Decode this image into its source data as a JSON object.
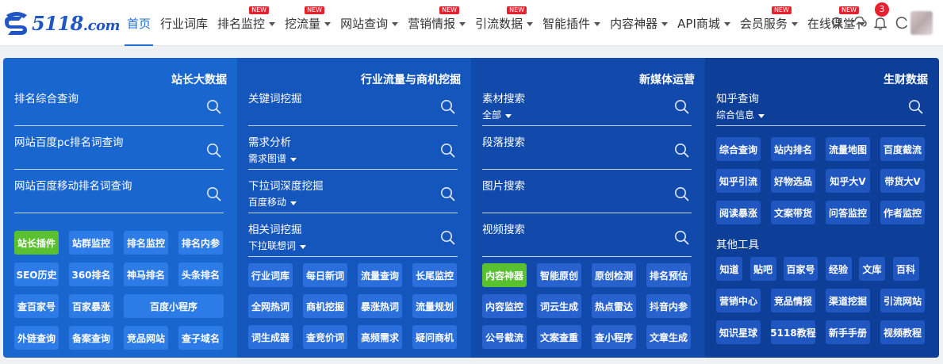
{
  "logo": {
    "text_main": "5118",
    "text_suffix": ".com"
  },
  "nav": [
    {
      "label": "首页",
      "caret": false,
      "new": false,
      "active": true
    },
    {
      "label": "行业词库",
      "caret": false,
      "new": false
    },
    {
      "label": "排名监控",
      "caret": true,
      "new": true
    },
    {
      "label": "挖流量",
      "caret": true,
      "new": true
    },
    {
      "label": "网站查询",
      "caret": true,
      "new": false
    },
    {
      "label": "营销情报",
      "caret": true,
      "new": true
    },
    {
      "label": "引流数据",
      "caret": true,
      "new": true
    },
    {
      "label": "智能插件",
      "caret": true,
      "new": false
    },
    {
      "label": "内容神器",
      "caret": true,
      "new": false
    },
    {
      "label": "API商城",
      "caret": true,
      "new": false
    },
    {
      "label": "会员服务",
      "caret": true,
      "new": true
    },
    {
      "label": "在线课堂",
      "caret": true,
      "new": true
    }
  ],
  "new_badge": "NEW",
  "notification_count": "3",
  "icons": {
    "search": "search-icon",
    "cloud": "cloud-upload-icon",
    "bell": "bell-icon",
    "refresh": "refresh-icon"
  },
  "colors": {
    "accent": "#1f6fd8",
    "green": "#59c130",
    "badge": "#e8212e"
  },
  "panels": [
    {
      "title": "站长大数据",
      "fields": [
        {
          "label": "排名综合查询",
          "sub": ""
        },
        {
          "label": "网站百度pc排名词查询",
          "sub": ""
        },
        {
          "label": "网站百度移动排名词查询",
          "sub": ""
        }
      ],
      "buttons": [
        [
          "站长插件",
          "站群监控",
          "排名监控",
          "排名内参"
        ],
        [
          "SEO历史",
          "360排名",
          "神马排名",
          "头条排名"
        ],
        [
          "查百家号",
          "百家暴涨",
          "百度小程序"
        ],
        [
          "外链查询",
          "备案查询",
          "竞品网站",
          "查子域名"
        ]
      ]
    },
    {
      "title": "行业流量与商机挖掘",
      "fields": [
        {
          "label": "关键词挖掘",
          "sub": ""
        },
        {
          "label": "需求分析",
          "sub": "需求图谱"
        },
        {
          "label": "下拉词深度挖掘",
          "sub": "百度移动"
        },
        {
          "label": "相关词挖掘",
          "sub": "下拉联想词"
        }
      ],
      "buttons": [
        [
          "行业词库",
          "每日新词",
          "流量查询",
          "长尾监控"
        ],
        [
          "全网热词",
          "商机挖掘",
          "暴涨热词",
          "流量规划"
        ],
        [
          "词生成器",
          "查竞价词",
          "高频需求",
          "疑问商机"
        ]
      ]
    },
    {
      "title": "新媒体运营",
      "fields": [
        {
          "label": "素材搜索",
          "sub": "全部"
        },
        {
          "label": "段落搜索",
          "sub": ""
        },
        {
          "label": "图片搜索",
          "sub": ""
        },
        {
          "label": "视频搜索",
          "sub": ""
        }
      ],
      "buttons": [
        [
          "内容神器",
          "智能原创",
          "原创检测",
          "排名预估"
        ],
        [
          "内容监控",
          "词云生成",
          "热点雷达",
          "抖音内参"
        ],
        [
          "公号截流",
          "文案查重",
          "查小程序",
          "文章生成"
        ]
      ]
    },
    {
      "title": "生财数据",
      "fields": [
        {
          "label": "知乎查询",
          "sub": "综合信息"
        }
      ],
      "buttons": [
        [
          "综合查询",
          "站内排名",
          "流量地图",
          "百度截流"
        ],
        [
          "知乎引流",
          "好物选品",
          "知乎大V",
          "带货大V"
        ],
        [
          "阅读暴涨",
          "文案带货",
          "问答监控",
          "作者监控"
        ]
      ],
      "other_title": "其他工具",
      "other_buttons": [
        [
          "知道",
          "贴吧",
          "百家号",
          "经验",
          "文库",
          "百科"
        ],
        [
          "营销中心",
          "竞品情报",
          "渠道挖掘",
          "引流网站"
        ],
        [
          "知识星球",
          "5118教程",
          "新手手册",
          "视频教程"
        ]
      ]
    }
  ]
}
